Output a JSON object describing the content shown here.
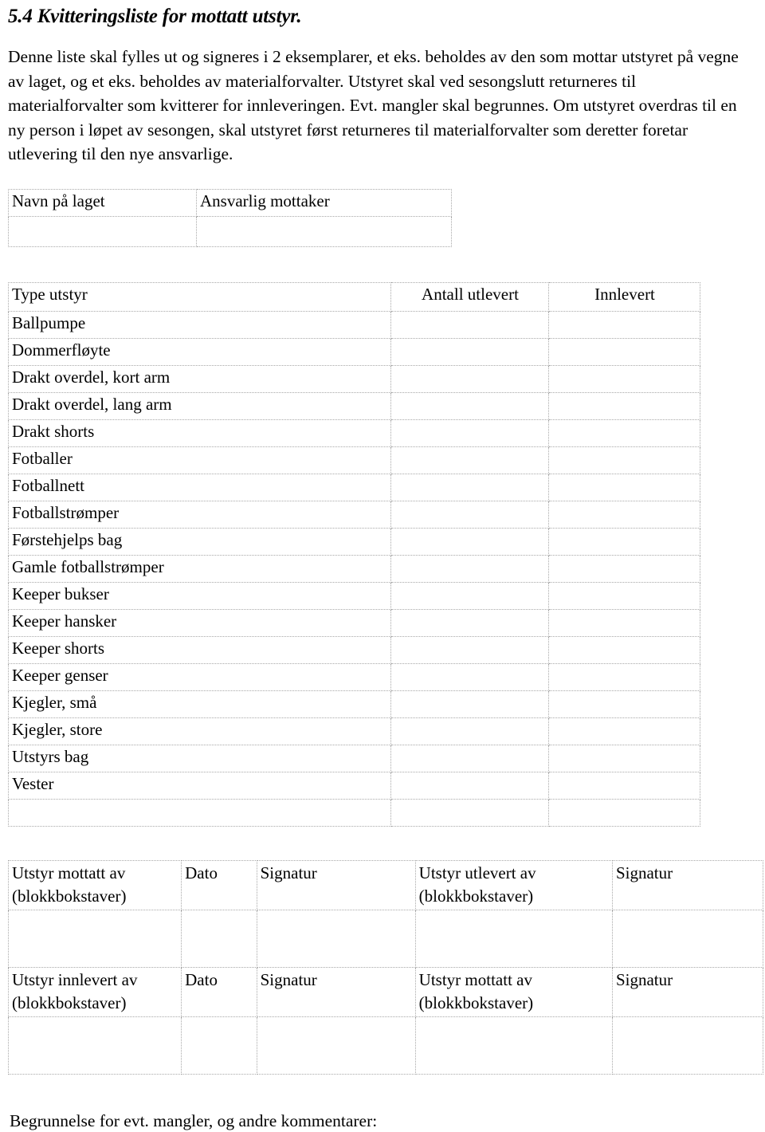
{
  "document": {
    "title": "5.4 Kvitteringsliste for mottatt utstyr.",
    "intro": "Denne liste skal fylles ut og signeres i 2 eksemplarer, et eks. beholdes av den som mottar utstyret på vegne av laget, og et eks. beholdes av materialforvalter. Utstyret skal ved sesongslutt returneres til materialforvalter som kvitterer for innleveringen. Evt. mangler skal begrunnes. Om utstyret overdras til en ny person i løpet av sesongen, skal utstyret først returneres til materialforvalter som deretter foretar utlevering til den nye ansvarlige.",
    "footnote": "Begrunnelse for evt. mangler, og andre kommentarer:"
  },
  "team_table": {
    "headers": [
      "Navn på laget",
      "Ansvarlig mottaker"
    ],
    "values": [
      "",
      ""
    ]
  },
  "equipment_table": {
    "headers": [
      "Type utstyr",
      "Antall utlevert",
      "Innlevert"
    ],
    "rows": [
      {
        "type": "Ballpumpe",
        "antall": "",
        "innlevert": ""
      },
      {
        "type": "Dommerfløyte",
        "antall": "",
        "innlevert": ""
      },
      {
        "type": "Drakt overdel, kort arm",
        "antall": "",
        "innlevert": ""
      },
      {
        "type": "Drakt overdel, lang arm",
        "antall": "",
        "innlevert": ""
      },
      {
        "type": "Drakt shorts",
        "antall": "",
        "innlevert": ""
      },
      {
        "type": "Fotballer",
        "antall": "",
        "innlevert": ""
      },
      {
        "type": "Fotballnett",
        "antall": "",
        "innlevert": ""
      },
      {
        "type": "Fotballstrømper",
        "antall": "",
        "innlevert": ""
      },
      {
        "type": "Førstehjelps bag",
        "antall": "",
        "innlevert": ""
      },
      {
        "type": "Gamle fotballstrømper",
        "antall": "",
        "innlevert": ""
      },
      {
        "type": "Keeper bukser",
        "antall": "",
        "innlevert": ""
      },
      {
        "type": "Keeper hansker",
        "antall": "",
        "innlevert": ""
      },
      {
        "type": "Keeper shorts",
        "antall": "",
        "innlevert": ""
      },
      {
        "type": "Keeper genser",
        "antall": "",
        "innlevert": ""
      },
      {
        "type": "Kjegler, små",
        "antall": "",
        "innlevert": ""
      },
      {
        "type": "Kjegler, store",
        "antall": "",
        "innlevert": ""
      },
      {
        "type": "Utstyrs bag",
        "antall": "",
        "innlevert": ""
      },
      {
        "type": "Vester",
        "antall": "",
        "innlevert": ""
      },
      {
        "type": "",
        "antall": "",
        "innlevert": ""
      }
    ]
  },
  "signature_table": {
    "row1": {
      "received_by": "Utstyr mottatt av (blokkbokstaver)",
      "date": "Dato",
      "signature_left": "Signatur",
      "handed_out_by": "Utstyr utlevert av (blokkbokstaver)",
      "signature_right": "Signatur"
    },
    "row1_values": {
      "received_by": "",
      "date": "",
      "signature_left": "",
      "handed_out_by": "",
      "signature_right": ""
    },
    "row2": {
      "returned_by": "Utstyr innlevert av (blokkbokstaver)",
      "date": "Dato",
      "signature_left": "Signatur",
      "received_by": "Utstyr mottatt av (blokkbokstaver)",
      "signature_right": "Signatur"
    },
    "row2_values": {
      "returned_by": "",
      "date": "",
      "signature_left": "",
      "received_by": "",
      "signature_right": ""
    }
  }
}
